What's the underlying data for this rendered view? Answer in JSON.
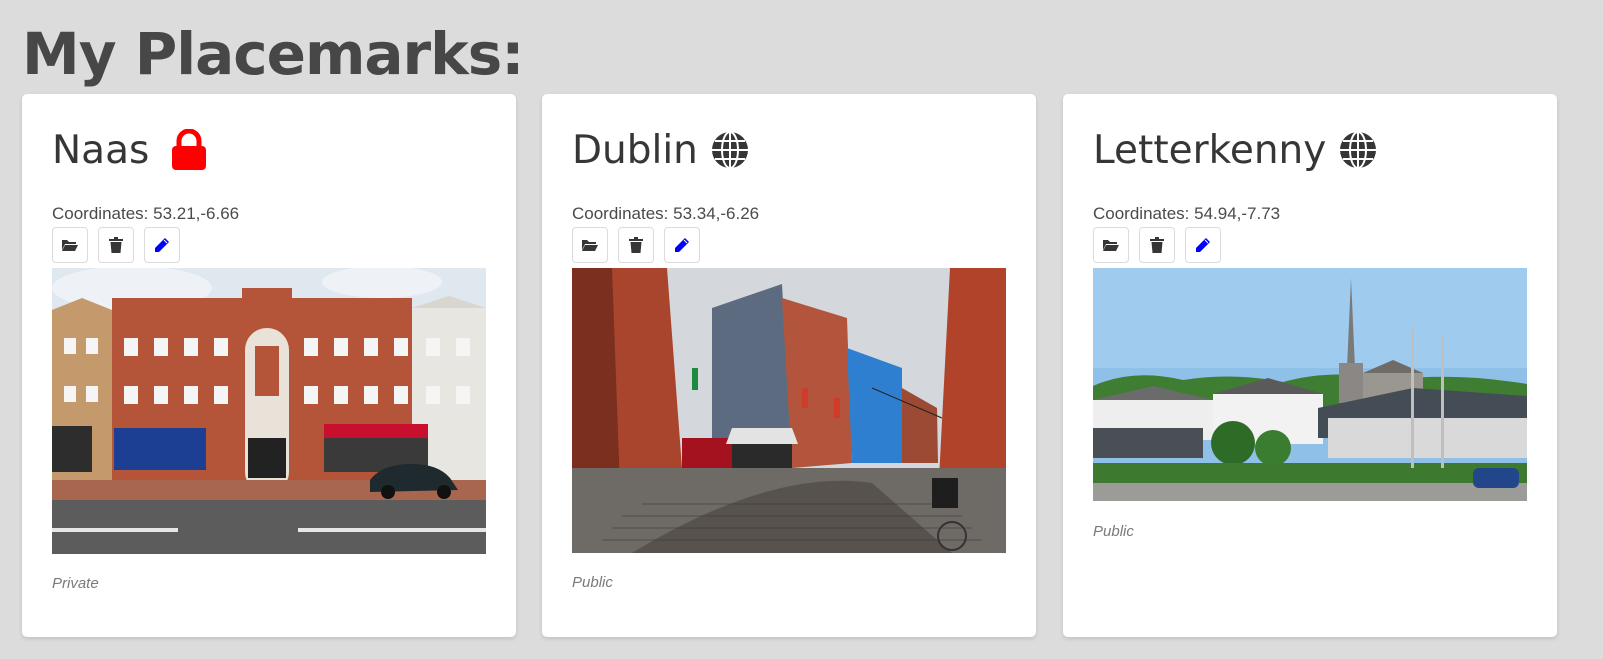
{
  "page": {
    "title": "My Placemarks:"
  },
  "placemarks": [
    {
      "name": "Naas",
      "status_icon": "lock-icon",
      "coordinates": "Coordinates: 53.21,-6.66",
      "visibility": "Private",
      "colors": {
        "status_icon": "#ff0000"
      }
    },
    {
      "name": "Dublin",
      "status_icon": "globe-icon",
      "coordinates": "Coordinates: 53.34,-6.26",
      "visibility": "Public",
      "colors": {
        "status_icon": "#363636"
      }
    },
    {
      "name": "Letterkenny",
      "status_icon": "globe-icon",
      "coordinates": "Coordinates: 54.94,-7.73",
      "visibility": "Public",
      "colors": {
        "status_icon": "#363636"
      }
    }
  ],
  "actions": {
    "open_icon": "folder-open-icon",
    "delete_icon": "trash-icon",
    "edit_icon": "pencil-icon",
    "colors": {
      "open": "#363636",
      "delete": "#363636",
      "edit": "#0000ff"
    }
  }
}
